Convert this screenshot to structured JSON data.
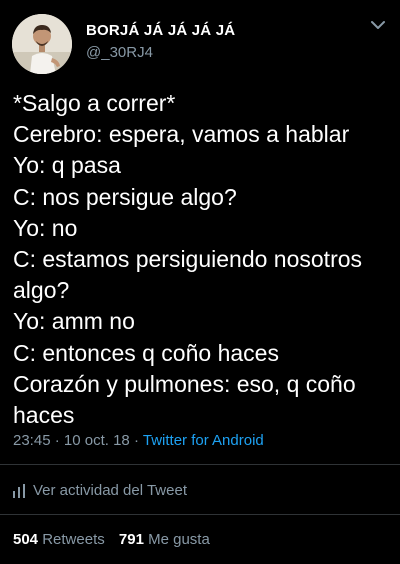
{
  "author": {
    "display_name": "BORJÁ JÁ JÁ JÁ JÁ",
    "handle": "@_30RJ4",
    "avatar_icon": "profile-photo"
  },
  "menu_icon": "chevron-down-icon",
  "tweet": {
    "lines": [
      "*Salgo a correr*",
      "Cerebro: espera, vamos a hablar",
      "Yo: q pasa",
      "C: nos persigue algo?",
      "Yo: no",
      "C: estamos persiguiendo nosotros",
      "algo?",
      "Yo: amm no",
      "C: entonces q coño haces",
      "Corazón y pulmones: eso, q coño",
      "haces"
    ],
    "time": "23:45",
    "separator": "·",
    "date": "10 oct. 18",
    "source": "Twitter for Android"
  },
  "activity": {
    "label": "Ver actividad del Tweet",
    "icon": "bar-chart-icon"
  },
  "stats": {
    "retweets_count": "504",
    "retweets_label": "Retweets",
    "likes_count": "791",
    "likes_label": "Me gusta"
  },
  "colors": {
    "background": "#000000",
    "text": "#ffffff",
    "muted": "#8899a6",
    "link": "#1da1f2",
    "divider": "#2f3336"
  }
}
